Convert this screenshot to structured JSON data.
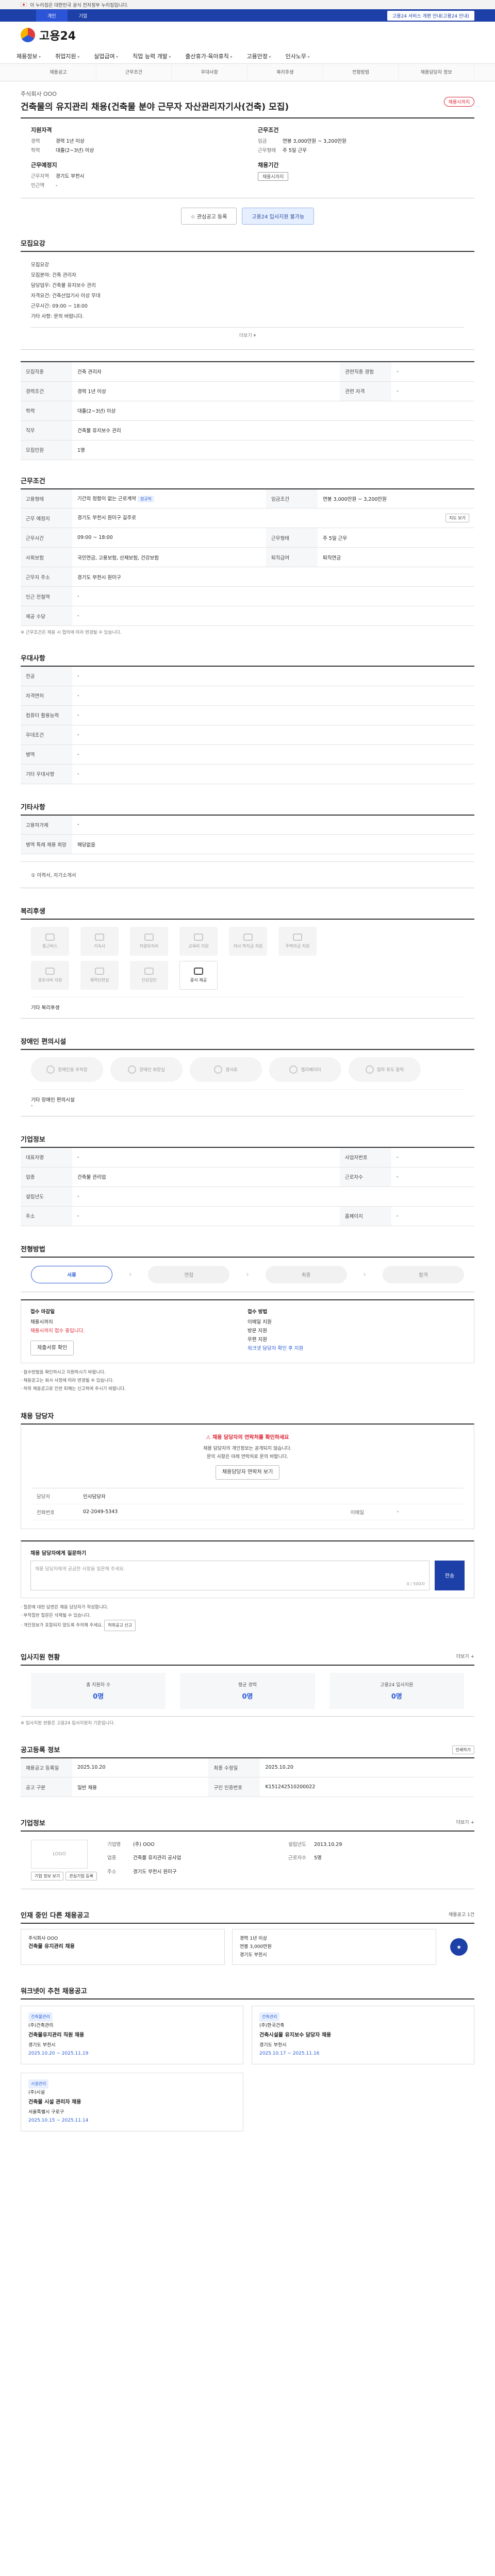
{
  "gov_banner": "이 누리집은 대한민국 공식 전자정부 누리집입니다.",
  "topbar": {
    "tab_active": "개인",
    "tab_other": "기업",
    "alert": "고용24 서비스 개편 안내(고용24 안내)"
  },
  "logo_text": "고용24",
  "gnb": [
    "채용정보",
    "취업지원",
    "실업급여",
    "직업 능력 개발",
    "출산휴가·육아휴직",
    "고용안정",
    "인사노무"
  ],
  "anchor_tabs": [
    "채용공고",
    "근무조건",
    "우대사항",
    "복리후생",
    "전형방법",
    "채용담당자 정보"
  ],
  "summary": {
    "company": "주식회사 OOO",
    "title": "건축물의 유지관리 채용(건축물 분야 근무자 자산관리자기사(건축) 모집)",
    "dday": "채용시까지",
    "left_heading": "지원자격",
    "left_rows": [
      {
        "k": "경력",
        "v": "경력 1년 이상"
      },
      {
        "k": "학력",
        "v": "대졸(2~3년) 이상"
      }
    ],
    "left_heading2": "근무예정지",
    "left_rows2": [
      {
        "k": "근무지역",
        "v": "경기도 부천시"
      },
      {
        "k": "인근역",
        "v": "-"
      }
    ],
    "right_heading": "근무조건",
    "right_rows": [
      {
        "k": "임금",
        "v": "연봉 3,000만원 ~ 3,200만원"
      },
      {
        "k": "근무형태",
        "v": "주 5일 근무"
      }
    ],
    "right_heading2": "채용기간",
    "right_pill": "채용시까지"
  },
  "buttons": {
    "save": "관심공고 등록",
    "apply": "고용24 입사지원 불가능"
  },
  "sec_recruit": {
    "title": "모집요강",
    "lines": [
      "모집요강",
      "모집분야: 건축 관리자",
      "담당업무: 건축물 유지보수 관리",
      "자격요건: 건축산업기사 이상 우대",
      "근무시간: 09:00 ~ 18:00",
      "기타 사항: 문의 바랍니다."
    ],
    "fold": "더보기 ▾"
  },
  "recruit_table": [
    [
      "모집직종",
      "건축 관리자",
      "관련직종 경험",
      "-"
    ],
    [
      "경력조건",
      "경력 1년 이상",
      "관련 자격",
      "-"
    ],
    [
      "학력",
      "대졸(2~3년) 이상",
      "",
      ""
    ],
    [
      "직무",
      "건축물 유지보수 관리",
      "",
      ""
    ],
    [
      "모집인원",
      "1명",
      "",
      ""
    ]
  ],
  "sec_work": {
    "title": "근무조건",
    "rows": [
      {
        "th": "고용형태",
        "v": "기간의 정함이 없는 근로계약",
        "tag": "정규직",
        "th2": "임금조건",
        "v2": "연봉 3,000만원 ~ 3,200만원"
      },
      {
        "th": "근무 예정지",
        "v": "경기도 부천시 원미구 길주로",
        "tag": "",
        "th2": "",
        "v2": ""
      },
      {
        "th": "근무시간",
        "v": "09:00 ~ 18:00",
        "tag": "",
        "th2": "근무형태",
        "v2": "주 5일 근무"
      },
      {
        "th": "사회보험",
        "v": "국민연금, 고용보험, 산재보험, 건강보험",
        "tag": "",
        "th2": "퇴직급여",
        "v2": "퇴직연금"
      },
      {
        "th": "근무지 주소",
        "v": "경기도 부천시 원미구",
        "tag": "",
        "th2": "",
        "v2": ""
      },
      {
        "th": "인근 전철역",
        "v": "-",
        "tag": "",
        "th2": "",
        "v2": ""
      },
      {
        "th": "제공 수당",
        "v": "-",
        "tag": "",
        "th2": "",
        "v2": ""
      }
    ],
    "map_btn": "지도 보기",
    "note": "※ 근무조건은 채용 시 협의에 따라 변경될 수 있습니다."
  },
  "sec_pref": {
    "title": "우대사항",
    "rows": [
      [
        "전공",
        "-"
      ],
      [
        "자격면허",
        "-"
      ],
      [
        "컴퓨터 활용능력",
        "-"
      ],
      [
        "우대조건",
        "-"
      ],
      [
        "병역",
        "-"
      ],
      [
        "기타 우대사항",
        "-"
      ]
    ]
  },
  "sec_etc": {
    "title": "기타사항",
    "rows": [
      [
        "고용허가제",
        "-"
      ],
      [
        "병역 특례 채용 희망",
        "해당없음"
      ]
    ]
  },
  "sec_extra": {
    "title": "제출서류",
    "text": "① 이력서, 자기소개서"
  },
  "sec_welfare": {
    "title": "복리후생",
    "items": [
      "통근버스",
      "기숙사",
      "차량유지비",
      "교육비 지원",
      "자녀 학자금 지원",
      "주택자금 지원",
      "경조사비 지원",
      "체력단련실",
      "건강검진",
      "중식 제공"
    ],
    "active_index": 9,
    "etc": "기타 복리후생"
  },
  "sec_disabled": {
    "title": "장애인 편의시설",
    "items": [
      "장애인용 주차장",
      "장애인 화장실",
      "경사로",
      "엘리베이터",
      "점자 유도 블럭"
    ],
    "etc": "기타 장애인 편의시설",
    "etc_value": "-"
  },
  "sec_company_info": {
    "title": "기업정보",
    "rows": [
      [
        "대표자명",
        "-",
        "사업자번호",
        "-"
      ],
      [
        "업종",
        "건축물 관리업",
        "근로자수",
        "-"
      ],
      [
        "설립년도",
        "-",
        "",
        ""
      ],
      [
        "주소",
        "-",
        "홈페이지",
        "-"
      ]
    ]
  },
  "sec_process": {
    "title": "전형방법",
    "steps": [
      "서류",
      "면접",
      "최종",
      "합격"
    ],
    "active": 0
  },
  "apply": {
    "col1_title": "접수 마감일",
    "col1_value": "채용시까지",
    "col1_red": "채용시까지 접수 중입니다.",
    "col2_title": "접수 방법",
    "col2_lines": [
      "이메일 지원",
      "방문 지원",
      "우편 지원"
    ],
    "col2_link": "워크넷 담당자 확인 후 지원",
    "btn": "제출서류 확인",
    "bullets": [
      "· 접수방법을 확인하시고 지원하시기 바랍니다.",
      "· 채용공고는 회사 사정에 따라 변경될 수 있습니다.",
      "· 허위 채용공고로 인한 피해는 신고하여 주시기 바랍니다."
    ]
  },
  "manager": {
    "title": "채용 담당자",
    "alert": "채용 담당자의 연락처를 확인하세요",
    "center_lines": [
      "채용 담당자의 개인정보는 공개되지 않습니다.",
      "문의 사항은 아래 연락처로 문의 바랍니다."
    ],
    "center_btn": "채용담당자 연락처 보기",
    "rows": [
      [
        "담당자",
        "인사담당자",
        "",
        ""
      ],
      [
        "전화번호",
        "02-2049-5343",
        "이메일",
        "-"
      ]
    ]
  },
  "inquiry": {
    "title": "채용 담당자에게 질문하기",
    "placeholder": "채용 담당자에게 궁금한 사항을 질문해 주세요.",
    "count": "0 / 500자",
    "send": "전송",
    "bullets": [
      "· 질문에 대한 답변은 채용 담당자가 작성합니다.",
      "· 부적절한 질문은 삭제될 수 있습니다.",
      "· 개인정보가 포함되지 않도록 주의해 주세요."
    ],
    "report_btn": "허위공고 신고"
  },
  "stats": {
    "title": "입사지원 현황",
    "more": "더보기 +",
    "items": [
      {
        "label": "총 지원자 수",
        "value": "0명"
      },
      {
        "label": "평균 경력",
        "value": "0명"
      },
      {
        "label": "고용24 입사지원",
        "value": "0명"
      }
    ],
    "note": "※ 입사지원 현황은 고용24 입사지원자 기준입니다."
  },
  "post_info": {
    "title": "공고등록 정보",
    "btn": "인쇄하기",
    "rows": [
      [
        "채용공고 등록일",
        "2025.10.20",
        "최종 수정일",
        "2025.10.20"
      ],
      [
        "공고 구분",
        "일반 채용",
        "구인 인증번호",
        "K151242510200022"
      ]
    ]
  },
  "company_box": {
    "title": "기업정보",
    "more": "더보기 +",
    "logo": "LOGO",
    "rows": [
      [
        "기업명",
        "(주) OOO",
        "설립년도",
        "2013.10.29"
      ],
      [
        "업종",
        "건축물 유지관리 공사업",
        "근로자수",
        "5명"
      ],
      [
        "주소",
        "경기도 부천시 원미구",
        "",
        ""
      ]
    ],
    "btns": [
      "기업 정보 보기",
      "관심기업 등록"
    ]
  },
  "same_company": {
    "title": "인재 중인 다른 채용공고",
    "note": "채용공고 1건",
    "card_title": "건축물 유지관리 채용",
    "card_sub": "주식회사 OOO",
    "card_rows": [
      "경력 1년 이상",
      "연봉 3,000만원",
      "경기도 부천시"
    ]
  },
  "recommend": {
    "title": "워크넷이 추천 채용공고",
    "cards": [
      {
        "tag": "건축물관리",
        "co": "(주)건축관리",
        "title": "건축물유지관리 직원 채용",
        "line": "경기도 부천시",
        "date": "2025.10.20 ~ 2025.11.19"
      },
      {
        "tag": "건축관리",
        "co": "(주)한국건축",
        "title": "건축시설물 유지보수 담당자 채용",
        "line": "경기도 부천시",
        "date": "2025.10.17 ~ 2025.11.16"
      },
      {
        "tag": "시설관리",
        "co": "(주)시설",
        "title": "건축물 시설 관리자 채용",
        "line": "서울특별시 구로구",
        "date": "2025.10.15 ~ 2025.11.14"
      }
    ]
  }
}
